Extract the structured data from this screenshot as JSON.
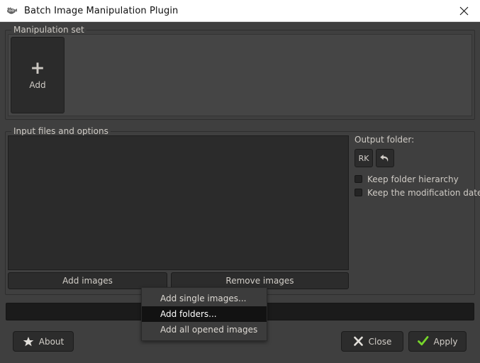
{
  "window": {
    "title": "Batch Image Manipulation Plugin",
    "icon": "wilber-icon",
    "close_icon": "close-icon"
  },
  "manipulation_set": {
    "title": "Manipulation set",
    "add_tile": {
      "plus": "+",
      "label": "Add",
      "icon": "plus-icon"
    }
  },
  "input_section": {
    "title": "Input files and options",
    "buttons": {
      "add_images": "Add images",
      "remove_images": "Remove images"
    },
    "output": {
      "label": "Output folder:",
      "path_button": "RK",
      "reset_button_icon": "undo-arrow-icon",
      "checkboxes": [
        {
          "label": "Keep folder hierarchy",
          "checked": false
        },
        {
          "label": "Keep the modification dates",
          "checked": false
        }
      ]
    }
  },
  "context_menu": {
    "items": [
      {
        "label": "Add single images...",
        "selected": false
      },
      {
        "label": "Add folders...",
        "selected": true
      },
      {
        "label": "Add all opened images",
        "selected": false
      }
    ]
  },
  "progress": {
    "value": 0,
    "text": ""
  },
  "footer": {
    "about": "About",
    "close": "Close",
    "apply": "Apply",
    "about_icon": "star-icon",
    "close_icon": "x-icon",
    "apply_icon": "check-icon"
  },
  "colors": {
    "window_bg": "#3f3f3f",
    "panel_dark": "#2b2b2b",
    "titlebar_bg": "#ffffff",
    "text": "#cfcbc5",
    "apply_green": "#77d62b",
    "menu_bg": "#3c3c3c",
    "menu_selected": "#121212"
  }
}
